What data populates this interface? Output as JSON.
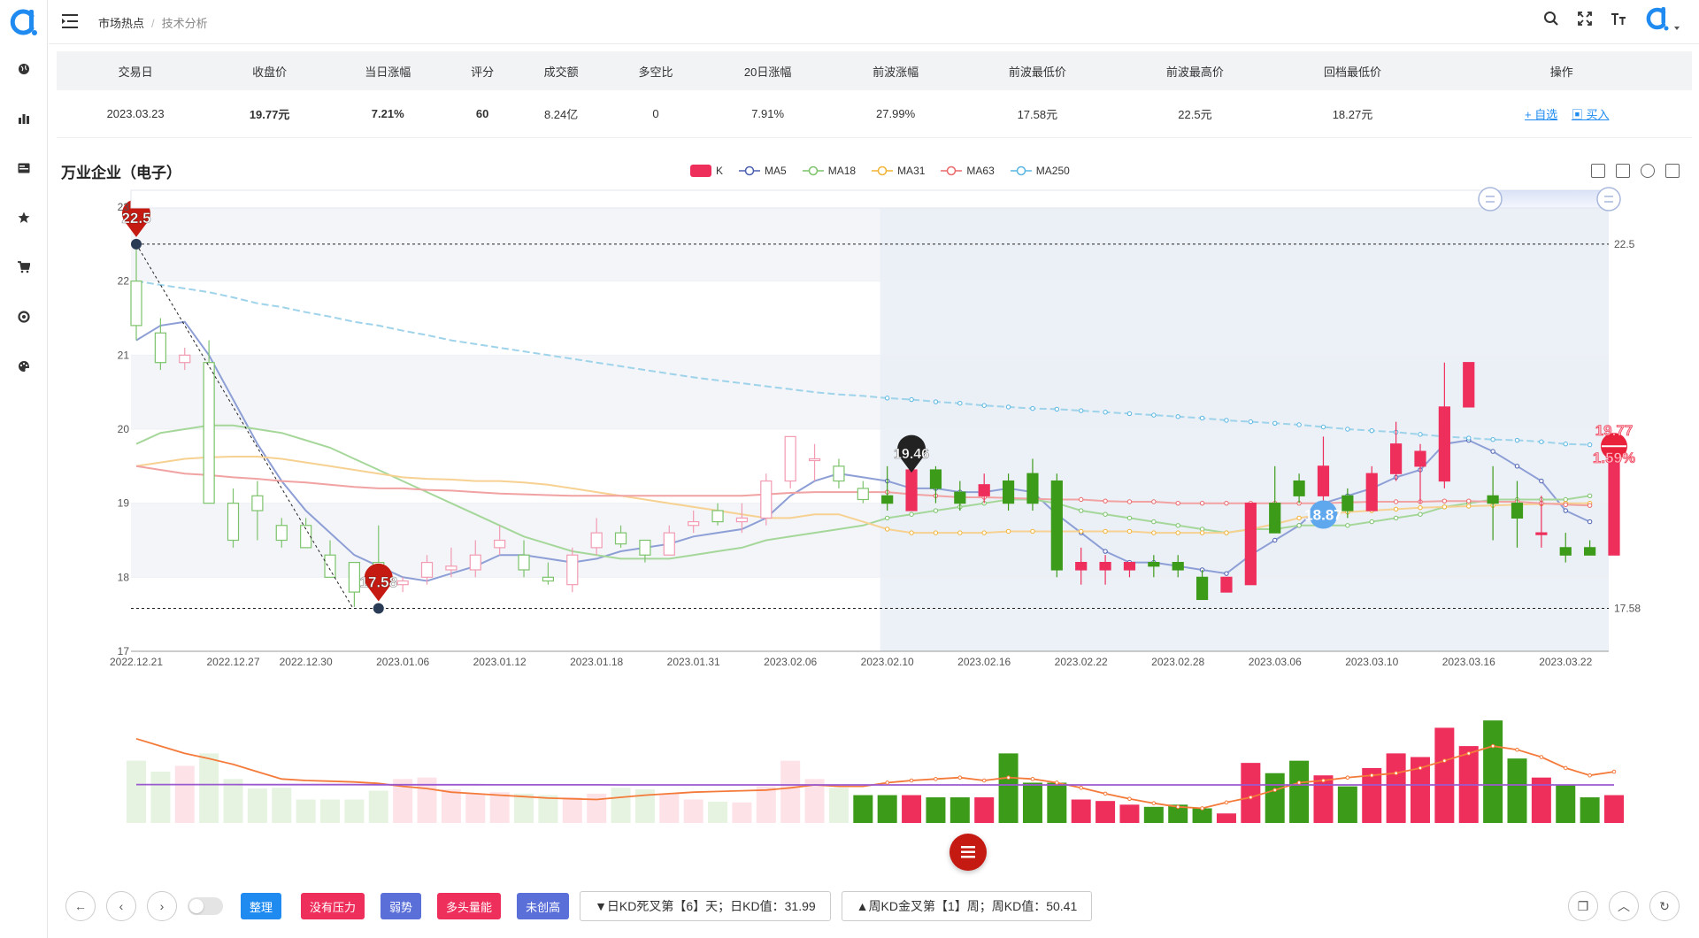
{
  "app": {
    "accent": "#1f8bf0"
  },
  "sidebar": {
    "items": [
      {
        "icon": "globe-icon"
      },
      {
        "icon": "bar-chart-icon"
      },
      {
        "icon": "card-icon"
      },
      {
        "icon": "star-icon"
      },
      {
        "icon": "cart-icon"
      },
      {
        "icon": "target-icon"
      },
      {
        "icon": "palette-icon"
      }
    ]
  },
  "breadcrumb": {
    "parent": "市场热点",
    "separator": "/",
    "current": "技术分析"
  },
  "table": {
    "headers": [
      "交易日",
      "收盘价",
      "当日涨幅",
      "评分",
      "成交额",
      "多空比",
      "20日涨幅",
      "前波涨幅",
      "前波最低价",
      "前波最高价",
      "回档最低价",
      "操作"
    ],
    "row": {
      "date": "2023.03.23",
      "close": "19.77元",
      "change": "7.21%",
      "score": "60",
      "amount": "8.24亿",
      "ratio": "0",
      "change20": "7.91%",
      "prev_wave": "27.99%",
      "prev_low": "17.58元",
      "prev_high": "22.5元",
      "pullback_low": "18.27元",
      "action_watch": "+ 自选",
      "action_buy": "买入"
    }
  },
  "chart": {
    "title": "万业企业（电子）",
    "legend": [
      {
        "name": "K",
        "color": "#ee2f5c"
      },
      {
        "name": "MA5",
        "color": "#4a5fb0"
      },
      {
        "name": "MA18",
        "color": "#7cc36b"
      },
      {
        "name": "MA31",
        "color": "#f2b233"
      },
      {
        "name": "MA63",
        "color": "#e9686a"
      },
      {
        "name": "MA250",
        "color": "#58b6e0"
      }
    ],
    "y_ticks": [
      "23",
      "22",
      "21",
      "20",
      "19",
      "18",
      "17"
    ],
    "x_ticks": [
      "2022.12.21",
      "2022.12.27",
      "2022.12.30",
      "2023.01.06",
      "2023.01.12",
      "2023.01.18",
      "2023.01.31",
      "2023.02.06",
      "2023.02.10",
      "2023.02.16",
      "2023.02.22",
      "2023.02.28",
      "2023.03.06",
      "2023.03.10",
      "2023.03.16",
      "2023.03.22"
    ],
    "marks": {
      "high": "22.5",
      "low": "17.58",
      "mid": "19.46",
      "blue": "18.87",
      "last": "19.77",
      "last_pct": "1.59%"
    }
  },
  "chart_data": {
    "type": "candlestick",
    "ylim": [
      17,
      23
    ],
    "hlines": [
      22.5,
      17.58
    ],
    "x": [
      "2022.12.21",
      "2022.12.22",
      "2022.12.23",
      "2022.12.26",
      "2022.12.27",
      "2022.12.28",
      "2022.12.29",
      "2022.12.30",
      "2023.01.03",
      "2023.01.04",
      "2023.01.05",
      "2023.01.06",
      "2023.01.09",
      "2023.01.10",
      "2023.01.11",
      "2023.01.12",
      "2023.01.13",
      "2023.01.16",
      "2023.01.17",
      "2023.01.18",
      "2023.01.19",
      "2023.01.20",
      "2023.01.30",
      "2023.01.31",
      "2023.02.01",
      "2023.02.02",
      "2023.02.03",
      "2023.02.06",
      "2023.02.07",
      "2023.02.08",
      "2023.02.09",
      "2023.02.10",
      "2023.02.13",
      "2023.02.14",
      "2023.02.15",
      "2023.02.16",
      "2023.02.17",
      "2023.02.20",
      "2023.02.21",
      "2023.02.22",
      "2023.02.23",
      "2023.02.24",
      "2023.02.27",
      "2023.02.28",
      "2023.03.01",
      "2023.03.02",
      "2023.03.03",
      "2023.03.06",
      "2023.03.07",
      "2023.03.08",
      "2023.03.09",
      "2023.03.10",
      "2023.03.13",
      "2023.03.14",
      "2023.03.15",
      "2023.03.16",
      "2023.03.17",
      "2023.03.20",
      "2023.03.21",
      "2023.03.22",
      "2023.03.23"
    ],
    "ohlc": [
      [
        22.0,
        21.4,
        22.5,
        21.2
      ],
      [
        21.3,
        20.9,
        21.5,
        20.8
      ],
      [
        20.9,
        21.0,
        21.1,
        20.8
      ],
      [
        20.9,
        19.0,
        21.2,
        19.0
      ],
      [
        19.0,
        18.5,
        19.2,
        18.4
      ],
      [
        19.1,
        18.9,
        19.3,
        18.5
      ],
      [
        18.7,
        18.5,
        18.8,
        18.4
      ],
      [
        18.7,
        18.4,
        18.8,
        18.4
      ],
      [
        18.3,
        18.0,
        18.5,
        18.0
      ],
      [
        18.2,
        17.8,
        18.2,
        17.6
      ],
      [
        18.2,
        17.9,
        18.7,
        17.8
      ],
      [
        17.9,
        17.95,
        18.0,
        17.8
      ],
      [
        18.0,
        18.2,
        18.3,
        17.9
      ],
      [
        18.1,
        18.15,
        18.4,
        18.0
      ],
      [
        18.1,
        18.3,
        18.5,
        18.0
      ],
      [
        18.4,
        18.5,
        18.7,
        18.3
      ],
      [
        18.3,
        18.1,
        18.5,
        18.0
      ],
      [
        18.0,
        17.95,
        18.2,
        17.9
      ],
      [
        17.9,
        18.3,
        18.4,
        17.8
      ],
      [
        18.4,
        18.6,
        18.8,
        18.3
      ],
      [
        18.6,
        18.45,
        18.7,
        18.4
      ],
      [
        18.5,
        18.3,
        18.5,
        18.2
      ],
      [
        18.3,
        18.6,
        18.7,
        18.3
      ],
      [
        18.7,
        18.75,
        18.9,
        18.6
      ],
      [
        18.9,
        18.75,
        19.0,
        18.7
      ],
      [
        18.75,
        18.8,
        19.0,
        18.6
      ],
      [
        18.8,
        19.3,
        19.4,
        18.7
      ],
      [
        19.3,
        19.9,
        19.9,
        19.2
      ],
      [
        19.6,
        19.6,
        19.8,
        19.3
      ],
      [
        19.5,
        19.3,
        19.6,
        19.2
      ],
      [
        19.2,
        19.05,
        19.3,
        19.0
      ],
      [
        19.1,
        19.0,
        19.5,
        18.9
      ],
      [
        18.9,
        19.45,
        19.5,
        18.9
      ],
      [
        19.45,
        19.2,
        19.5,
        19.0
      ],
      [
        19.15,
        19.0,
        19.3,
        18.9
      ],
      [
        19.1,
        19.25,
        19.4,
        19.0
      ],
      [
        19.3,
        19.0,
        19.4,
        18.9
      ],
      [
        19.4,
        19.0,
        19.6,
        18.9
      ],
      [
        19.3,
        18.1,
        19.4,
        18.0
      ],
      [
        18.1,
        18.2,
        18.4,
        17.9
      ],
      [
        18.1,
        18.2,
        18.3,
        17.9
      ],
      [
        18.1,
        18.2,
        18.2,
        18.0
      ],
      [
        18.2,
        18.15,
        18.3,
        18.0
      ],
      [
        18.2,
        18.1,
        18.3,
        18.0
      ],
      [
        18.0,
        17.7,
        18.1,
        17.7
      ],
      [
        17.8,
        18.0,
        18.0,
        17.8
      ],
      [
        17.9,
        19.0,
        19.0,
        17.9
      ],
      [
        19.0,
        18.6,
        19.5,
        18.6
      ],
      [
        19.3,
        19.1,
        19.4,
        19.0
      ],
      [
        19.1,
        19.5,
        19.9,
        19.0
      ],
      [
        19.1,
        18.9,
        19.2,
        18.8
      ],
      [
        18.9,
        19.4,
        19.5,
        18.9
      ],
      [
        19.4,
        19.8,
        20.1,
        19.3
      ],
      [
        19.5,
        19.7,
        19.8,
        19.0
      ],
      [
        19.3,
        20.3,
        20.9,
        19.2
      ],
      [
        20.3,
        20.9,
        20.9,
        20.3
      ],
      [
        19.1,
        19.0,
        19.5,
        18.5
      ],
      [
        19.0,
        18.8,
        19.3,
        18.4
      ],
      [
        18.6,
        18.6,
        19.1,
        18.4
      ],
      [
        18.4,
        18.3,
        18.6,
        18.2
      ],
      [
        18.4,
        18.3,
        18.5,
        18.3
      ],
      [
        18.3,
        19.77,
        19.8,
        18.3
      ]
    ],
    "series": [
      {
        "name": "MA5",
        "values": [
          21.2,
          21.4,
          21.45,
          21.0,
          20.4,
          19.8,
          19.3,
          18.9,
          18.6,
          18.3,
          18.15,
          18.0,
          17.95,
          18.05,
          18.15,
          18.3,
          18.3,
          18.25,
          18.2,
          18.25,
          18.35,
          18.4,
          18.45,
          18.55,
          18.6,
          18.65,
          18.8,
          19.1,
          19.3,
          19.4,
          19.35,
          19.3,
          19.2,
          19.2,
          19.15,
          19.15,
          19.2,
          19.15,
          18.85,
          18.6,
          18.35,
          18.2,
          18.2,
          18.15,
          18.1,
          18.05,
          18.3,
          18.5,
          18.7,
          19.0,
          19.1,
          19.2,
          19.35,
          19.45,
          19.8,
          19.85,
          19.7,
          19.5,
          19.3,
          18.9,
          18.75
        ]
      },
      {
        "name": "MA18",
        "values": [
          19.8,
          19.95,
          20.0,
          20.05,
          20.05,
          20.0,
          19.95,
          19.85,
          19.75,
          19.6,
          19.45,
          19.3,
          19.15,
          19.0,
          18.85,
          18.7,
          18.55,
          18.45,
          18.35,
          18.3,
          18.25,
          18.25,
          18.25,
          18.3,
          18.35,
          18.4,
          18.5,
          18.55,
          18.6,
          18.65,
          18.7,
          18.8,
          18.85,
          18.9,
          18.95,
          19.0,
          19.05,
          19.05,
          19.0,
          18.9,
          18.85,
          18.8,
          18.75,
          18.7,
          18.65,
          18.6,
          18.65,
          18.65,
          18.7,
          18.7,
          18.7,
          18.75,
          18.8,
          18.85,
          18.95,
          19.0,
          19.05,
          19.05,
          19.05,
          19.05,
          19.1
        ]
      },
      {
        "name": "MA31",
        "values": [
          19.5,
          19.55,
          19.6,
          19.62,
          19.63,
          19.63,
          19.6,
          19.55,
          19.5,
          19.45,
          19.4,
          19.35,
          19.33,
          19.32,
          19.3,
          19.3,
          19.28,
          19.25,
          19.2,
          19.15,
          19.1,
          19.05,
          19.0,
          18.95,
          18.9,
          18.85,
          18.8,
          18.8,
          18.85,
          18.85,
          18.75,
          18.65,
          18.6,
          18.6,
          18.6,
          18.6,
          18.62,
          18.62,
          18.62,
          18.62,
          18.62,
          18.62,
          18.6,
          18.6,
          18.6,
          18.6,
          18.65,
          18.72,
          18.8,
          18.85,
          18.88,
          18.9,
          18.92,
          18.94,
          18.95,
          18.96,
          18.97,
          18.98,
          18.99,
          19.0,
          19.0
        ]
      },
      {
        "name": "MA63",
        "values": [
          19.5,
          19.45,
          19.4,
          19.38,
          19.35,
          19.33,
          19.3,
          19.28,
          19.25,
          19.22,
          19.2,
          19.2,
          19.18,
          19.17,
          19.15,
          19.13,
          19.12,
          19.11,
          19.1,
          19.1,
          19.1,
          19.1,
          19.1,
          19.1,
          19.1,
          19.1,
          19.12,
          19.14,
          19.15,
          19.15,
          19.15,
          19.15,
          19.12,
          19.1,
          19.08,
          19.08,
          19.07,
          19.06,
          19.05,
          19.05,
          19.03,
          19.02,
          19.02,
          19.0,
          19.0,
          19.0,
          19.0,
          19.0,
          19.0,
          19.0,
          19.01,
          19.02,
          19.02,
          19.02,
          19.03,
          19.03,
          19.02,
          19.02,
          19.0,
          18.98,
          18.97
        ]
      },
      {
        "name": "MA250",
        "values": [
          22.0,
          21.95,
          21.9,
          21.85,
          21.78,
          21.7,
          21.65,
          21.58,
          21.52,
          21.45,
          21.4,
          21.33,
          21.27,
          21.2,
          21.15,
          21.1,
          21.05,
          21.0,
          20.95,
          20.9,
          20.85,
          20.8,
          20.75,
          20.7,
          20.66,
          20.62,
          20.58,
          20.54,
          20.5,
          20.47,
          20.45,
          20.42,
          20.4,
          20.37,
          20.35,
          20.32,
          20.3,
          20.28,
          20.27,
          20.25,
          20.23,
          20.21,
          20.19,
          20.17,
          20.15,
          20.12,
          20.1,
          20.08,
          20.06,
          20.03,
          20.0,
          19.98,
          19.96,
          19.93,
          19.9,
          19.88,
          19.86,
          19.85,
          19.83,
          19.8,
          19.79
        ]
      }
    ],
    "volume": [
      0.85,
      0.7,
      0.78,
      0.95,
      0.6,
      0.47,
      0.48,
      0.32,
      0.32,
      0.32,
      0.44,
      0.6,
      0.62,
      0.46,
      0.4,
      0.42,
      0.4,
      0.38,
      0.35,
      0.4,
      0.48,
      0.46,
      0.4,
      0.32,
      0.29,
      0.28,
      0.5,
      0.85,
      0.6,
      0.48,
      0.38,
      0.38,
      0.38,
      0.35,
      0.35,
      0.35,
      0.95,
      0.55,
      0.55,
      0.32,
      0.3,
      0.25,
      0.22,
      0.25,
      0.2,
      0.13,
      0.82,
      0.68,
      0.85,
      0.65,
      0.5,
      0.75,
      0.95,
      0.9,
      1.3,
      1.05,
      1.4,
      0.88,
      0.62,
      0.52,
      0.35,
      0.38
    ],
    "volume_ma": [
      1.15,
      1.05,
      0.95,
      0.88,
      0.8,
      0.7,
      0.6,
      0.58,
      0.57,
      0.56,
      0.54,
      0.5,
      0.47,
      0.42,
      0.4,
      0.38,
      0.36,
      0.34,
      0.33,
      0.32,
      0.35,
      0.38,
      0.4,
      0.42,
      0.43,
      0.44,
      0.45,
      0.48,
      0.52,
      0.5,
      0.5,
      0.55,
      0.58,
      0.6,
      0.62,
      0.58,
      0.62,
      0.6,
      0.55,
      0.48,
      0.4,
      0.33,
      0.27,
      0.22,
      0.2,
      0.28,
      0.35,
      0.45,
      0.55,
      0.58,
      0.62,
      0.65,
      0.68,
      0.75,
      0.85,
      0.95,
      1.05,
      1.0,
      0.9,
      0.75,
      0.65,
      0.7
    ]
  },
  "bottom": {
    "tags": [
      {
        "label": "整理",
        "color": "#1f8bf0"
      },
      {
        "label": "没有压力",
        "color": "#ee2f5c"
      },
      {
        "label": "弱势",
        "color": "#5b6fd9"
      },
      {
        "label": "多头量能",
        "color": "#ee2f5c"
      },
      {
        "label": "未创高",
        "color": "#5b6fd9"
      }
    ],
    "kd_daily": "▼日KD死叉第【6】天；日KD值：31.99",
    "kd_weekly": "▲周KD金叉第【1】周；周KD值：50.41"
  }
}
